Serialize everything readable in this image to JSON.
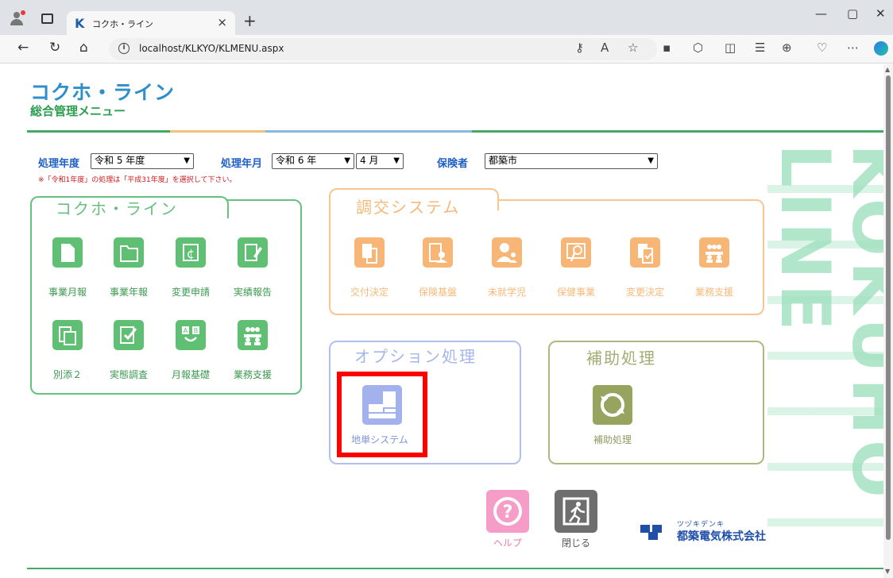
{
  "browser": {
    "tab_title": "コクホ・ライン",
    "tab_favicon": "K",
    "url": "localhost/KLKYO/KLMENU.aspx"
  },
  "header": {
    "title": "コクホ・ライン",
    "subtitle": "総合管理メニュー",
    "brand_vertical": "KOKUHO LINE"
  },
  "filters": {
    "fiscal_year_label": "処理年度",
    "fiscal_year_value": "令和 5 年度",
    "process_month_label": "処理年月",
    "process_year_value": "令和 6 年",
    "process_month_value": "4 月",
    "insurer_label": "保険者",
    "insurer_value": "都築市",
    "note": "※「令和1年度」の処理は「平成31年度」を選択して下さい。"
  },
  "panels": {
    "kokuho": {
      "title": "コクホ・ライン",
      "items": [
        {
          "label": "事業月報",
          "icon": "document-icon"
        },
        {
          "label": "事業年報",
          "icon": "folder-icon"
        },
        {
          "label": "変更申請",
          "icon": "edit-currency-icon"
        },
        {
          "label": "実績報告",
          "icon": "pen-report-icon"
        },
        {
          "label": "別添２",
          "icon": "copy-pages-icon"
        },
        {
          "label": "実態調査",
          "icon": "checklist-icon"
        },
        {
          "label": "月報基礎",
          "icon": "ab-icon"
        },
        {
          "label": "業務支援",
          "icon": "people-group-icon"
        }
      ]
    },
    "choko": {
      "title": "調交システム",
      "items": [
        {
          "label": "交付決定",
          "icon": "document-stamp-icon"
        },
        {
          "label": "保険基盤",
          "icon": "user-card-icon"
        },
        {
          "label": "未就学児",
          "icon": "child-icon"
        },
        {
          "label": "保健事業",
          "icon": "search-doc-icon"
        },
        {
          "label": "変更決定",
          "icon": "doc-check-icon"
        },
        {
          "label": "業務支援",
          "icon": "people-group-icon"
        }
      ]
    },
    "option": {
      "title": "オプション処理",
      "items": [
        {
          "label": "地単システム",
          "icon": "building-map-icon"
        }
      ]
    },
    "hojo": {
      "title": "補助処理",
      "items": [
        {
          "label": "補助処理",
          "icon": "refresh-cycle-icon"
        }
      ]
    }
  },
  "footer": {
    "help_label": "ヘルプ",
    "close_label": "閉じる",
    "company_kana": "ツヅキデンキ",
    "company_name": "都築電気株式会社"
  },
  "colors": {
    "green": "#57b870",
    "orange": "#f5b978",
    "blue": "#a6b6ea",
    "olive": "#a3ad74",
    "highlight": "#ff0000"
  }
}
